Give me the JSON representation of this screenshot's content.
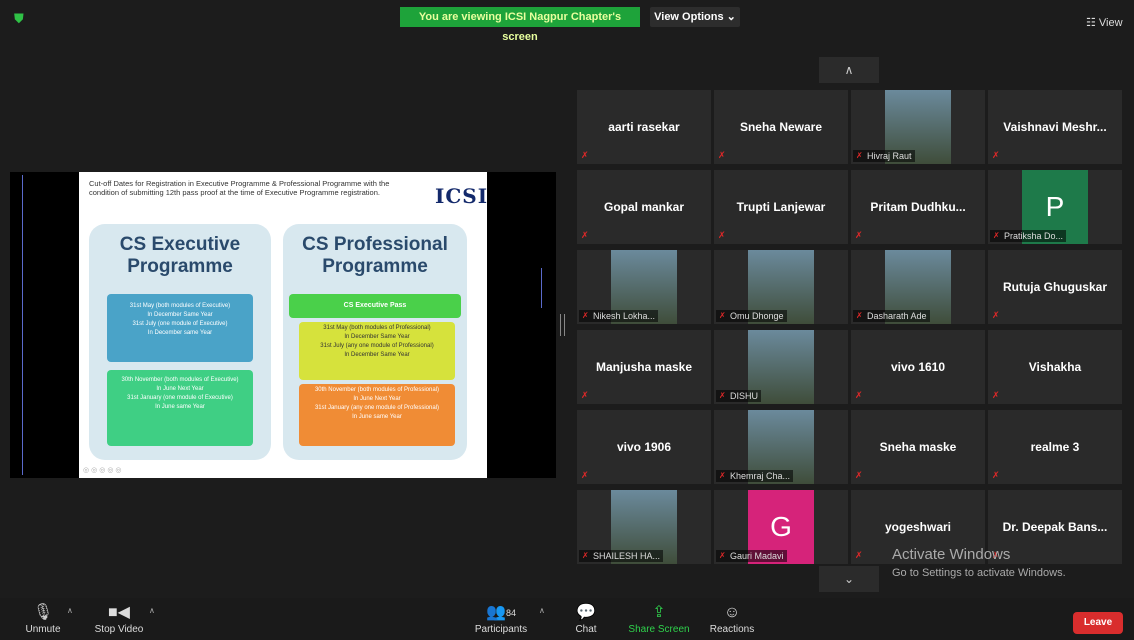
{
  "topbar": {
    "viewing_banner": "You are viewing ICSI Nagpur Chapter's screen",
    "view_options": "View Options ⌄",
    "view_button": "☷ View"
  },
  "slide": {
    "title": "Cut-off Dates for Registration in Executive Programme & Professional Programme with the condition of submitting 12th pass proof at the time of Executive Programme registration.",
    "logo": "ICSI",
    "exec_heading_1": "CS Executive",
    "exec_heading_2": "Programme",
    "prof_heading_1": "CS Professional",
    "prof_heading_2": "Programme",
    "exec_box1": [
      "31st May (both modules of Executive)",
      "In December Same Year",
      "31st July (one module of Executive)",
      "In December same Year"
    ],
    "exec_box2": [
      "30th November (both modules of Executive)",
      "In June Next Year",
      "31st January (one module of Executive)",
      "In June same Year"
    ],
    "prof_pass": "CS Executive Pass",
    "prof_box1": [
      "31st May (both modules of Professional)",
      "In December Same Year",
      "31st July (any one module of Professional)",
      "In December Same Year"
    ],
    "prof_box2": [
      "30th November (both modules of Professional)",
      "In June Next Year",
      "31st January (any one module of Professional)",
      "In June same Year"
    ],
    "footer_dots": "◎◎◎◎◎"
  },
  "participants_grid": [
    {
      "name": "aarti rasekar",
      "type": "name"
    },
    {
      "name": "Sneha Neware",
      "type": "name"
    },
    {
      "name": "Hivraj Raut",
      "type": "video"
    },
    {
      "name": "Vaishnavi Meshr...",
      "type": "name"
    },
    {
      "name": "Gopal mankar",
      "type": "name"
    },
    {
      "name": "Trupti Lanjewar",
      "type": "name"
    },
    {
      "name": "Pritam Dudhku...",
      "type": "name"
    },
    {
      "name": "Pratiksha Do...",
      "type": "avatar",
      "initial": "P",
      "color": "#1e7a4a"
    },
    {
      "name": "Nikesh Lokha...",
      "type": "video"
    },
    {
      "name": "Omu Dhonge",
      "type": "video"
    },
    {
      "name": "Dasharath Ade",
      "type": "video"
    },
    {
      "name": "Rutuja Ghuguskar",
      "type": "name"
    },
    {
      "name": "Manjusha maske",
      "type": "name"
    },
    {
      "name": "DISHU",
      "type": "video"
    },
    {
      "name": "vivo 1610",
      "type": "name"
    },
    {
      "name": "Vishakha",
      "type": "name"
    },
    {
      "name": "vivo 1906",
      "type": "name"
    },
    {
      "name": "Khemraj Cha...",
      "type": "video"
    },
    {
      "name": "Sneha maske",
      "type": "name"
    },
    {
      "name": "realme 3",
      "type": "name"
    },
    {
      "name": "SHAILESH HA...",
      "type": "video"
    },
    {
      "name": "Gauri Madavi",
      "type": "avatar",
      "initial": "G",
      "color": "#d6237a"
    },
    {
      "name": "yogeshwari",
      "type": "name"
    },
    {
      "name": "Dr. Deepak Bans...",
      "type": "name"
    }
  ],
  "watermark": {
    "line1": "Activate Windows",
    "line2": "Go to Settings to activate Windows."
  },
  "bottombar": {
    "unmute": "Unmute",
    "stop_video": "Stop Video",
    "participants": "Participants",
    "participants_count": "84",
    "chat": "Chat",
    "share_screen": "Share Screen",
    "reactions": "Reactions",
    "leave": "Leave"
  },
  "colors": {
    "share_green": "#1ea33a",
    "leave_red": "#d92d2d",
    "muted_red": "#e02828"
  }
}
